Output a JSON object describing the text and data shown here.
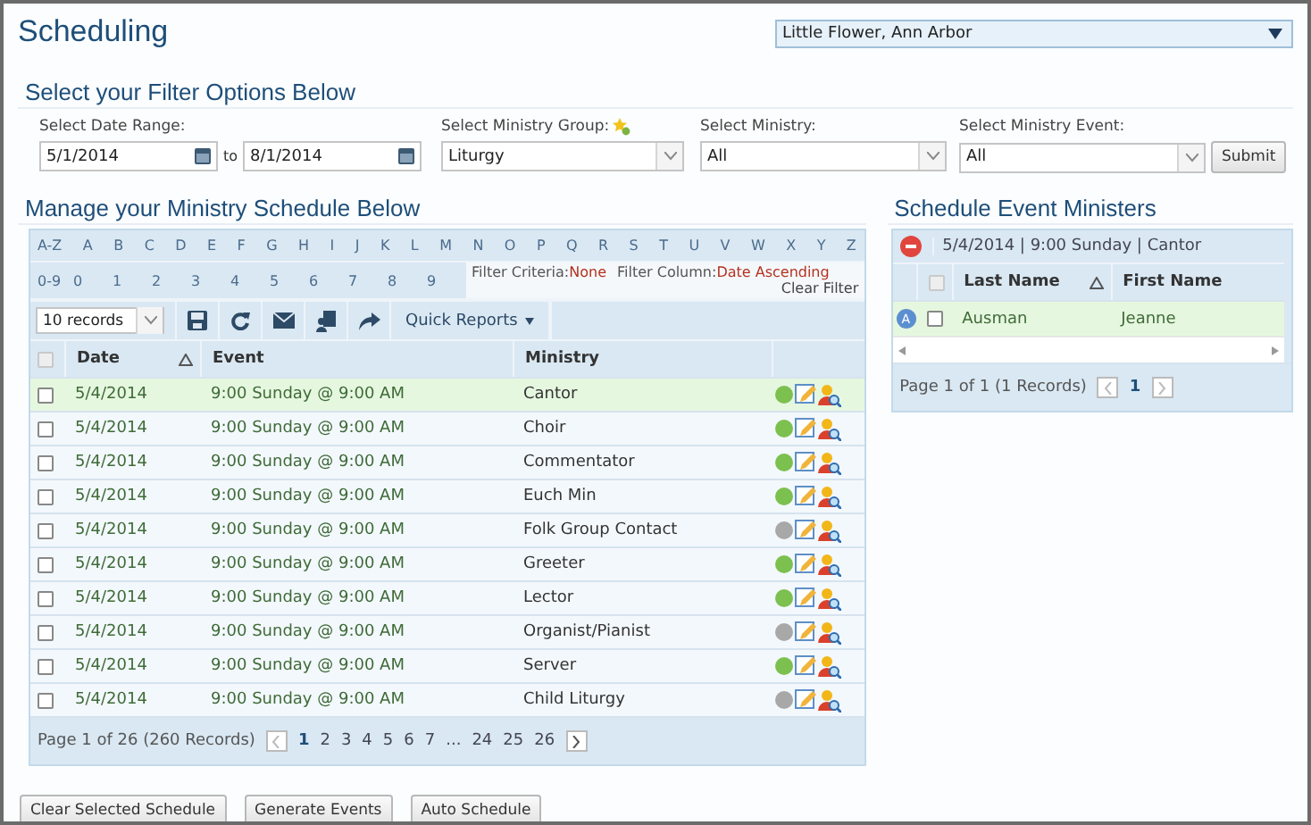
{
  "title": "Scheduling",
  "parish": {
    "value": "Little Flower, Ann Arbor"
  },
  "filter": {
    "heading": "Select your Filter Options Below",
    "date_range": {
      "label": "Select Date Range:",
      "from": "5/1/2014",
      "to_label": "to",
      "to": "8/1/2014"
    },
    "ministry_group": {
      "label": "Select Ministry Group:",
      "value": "Liturgy"
    },
    "ministry": {
      "label": "Select Ministry:",
      "value": "All"
    },
    "ministry_event": {
      "label": "Select Ministry Event:",
      "value": "All"
    },
    "submit": "Submit"
  },
  "schedule": {
    "heading": "Manage your Ministry Schedule Below",
    "letters": [
      "A-Z",
      "A",
      "B",
      "C",
      "D",
      "E",
      "F",
      "G",
      "H",
      "I",
      "J",
      "K",
      "L",
      "M",
      "N",
      "O",
      "P",
      "Q",
      "R",
      "S",
      "T",
      "U",
      "V",
      "W",
      "X",
      "Y",
      "Z"
    ],
    "digits": [
      "0-9",
      "0",
      "1",
      "2",
      "3",
      "4",
      "5",
      "6",
      "7",
      "8",
      "9"
    ],
    "filter_criteria": {
      "label": "Filter Criteria:",
      "value": "None"
    },
    "filter_column": {
      "label": "Filter Column:",
      "value": "Date Ascending"
    },
    "clear_filter": "Clear Filter",
    "all_checked": false,
    "page_size": "10 records",
    "quick_reports": "Quick Reports",
    "columns": [
      "Date",
      "Event",
      "Ministry"
    ],
    "rows": [
      {
        "date": "5/4/2014",
        "event": "9:00 Sunday @ 9:00 AM",
        "ministry": "Cantor",
        "checked": false,
        "selected": true,
        "color": "#7cc04f"
      },
      {
        "date": "5/4/2014",
        "event": "9:00 Sunday @ 9:00 AM",
        "ministry": "Choir",
        "checked": false,
        "selected": false,
        "color": "#7cc04f"
      },
      {
        "date": "5/4/2014",
        "event": "9:00 Sunday @ 9:00 AM",
        "ministry": "Commentator",
        "checked": false,
        "selected": false,
        "color": "#7cc04f"
      },
      {
        "date": "5/4/2014",
        "event": "9:00 Sunday @ 9:00 AM",
        "ministry": "Euch Min",
        "checked": false,
        "selected": false,
        "color": "#7cc04f"
      },
      {
        "date": "5/4/2014",
        "event": "9:00 Sunday @ 9:00 AM",
        "ministry": "Folk Group Contact",
        "checked": false,
        "selected": false,
        "color": "#a8a8a8"
      },
      {
        "date": "5/4/2014",
        "event": "9:00 Sunday @ 9:00 AM",
        "ministry": "Greeter",
        "checked": false,
        "selected": false,
        "color": "#7cc04f"
      },
      {
        "date": "5/4/2014",
        "event": "9:00 Sunday @ 9:00 AM",
        "ministry": "Lector",
        "checked": false,
        "selected": false,
        "color": "#7cc04f"
      },
      {
        "date": "5/4/2014",
        "event": "9:00 Sunday @ 9:00 AM",
        "ministry": "Organist/Pianist",
        "checked": false,
        "selected": false,
        "color": "#a8a8a8"
      },
      {
        "date": "5/4/2014",
        "event": "9:00 Sunday @ 9:00 AM",
        "ministry": "Server",
        "checked": false,
        "selected": false,
        "color": "#7cc04f"
      },
      {
        "date": "5/4/2014",
        "event": "9:00 Sunday @ 9:00 AM",
        "ministry": "Child Liturgy",
        "checked": false,
        "selected": false,
        "color": "#a8a8a8"
      }
    ],
    "pager": {
      "summary": "Page 1 of 26 (260 Records)",
      "pages": [
        {
          "label": "1",
          "selected": true
        },
        {
          "label": "2",
          "selected": false
        },
        {
          "label": "3",
          "selected": false
        },
        {
          "label": "4",
          "selected": false
        },
        {
          "label": "5",
          "selected": false
        },
        {
          "label": "6",
          "selected": false
        },
        {
          "label": "7",
          "selected": false
        },
        {
          "label": "...",
          "selected": false
        },
        {
          "label": "24",
          "selected": false
        },
        {
          "label": "25",
          "selected": false
        },
        {
          "label": "26",
          "selected": false
        }
      ]
    }
  },
  "ministers": {
    "heading": "Schedule Event Ministers",
    "event": "5/4/2014 | 9:00 Sunday | Cantor",
    "columns": [
      "Last Name",
      "First Name"
    ],
    "all_checked": false,
    "rows": [
      {
        "badge": "A",
        "last": "Ausman",
        "first": "Jeanne",
        "checked": false,
        "selected": true
      }
    ],
    "pager": {
      "summary": "Page 1 of 1 (1 Records)",
      "pages": [
        {
          "label": "1",
          "selected": true
        }
      ]
    }
  },
  "buttons": [
    "Clear Selected Schedule",
    "Generate Events",
    "Auto Schedule"
  ]
}
